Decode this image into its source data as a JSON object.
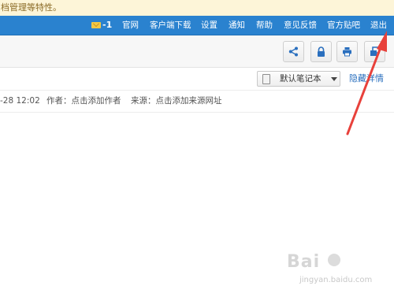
{
  "notice": {
    "text": "档管理等特性。"
  },
  "topnav": {
    "mail_count": "-1",
    "items": [
      {
        "label": "官网"
      },
      {
        "label": "客户端下载"
      },
      {
        "label": "设置"
      },
      {
        "label": "通知"
      },
      {
        "label": "帮助"
      },
      {
        "label": "意见反馈"
      },
      {
        "label": "官方贴吧"
      },
      {
        "label": "退出"
      }
    ],
    "colors": {
      "bar": "#2a82cf",
      "text": "#ffffff"
    }
  },
  "toolbar": {
    "buttons": [
      {
        "icon": "share-icon"
      },
      {
        "icon": "lock-icon"
      },
      {
        "icon": "print-icon"
      },
      {
        "icon": "window-icon"
      }
    ]
  },
  "notebook": {
    "selected": "默认笔记本",
    "hide_details": "隐藏详情"
  },
  "meta": {
    "date": "-28 12:02",
    "author": "作者：点击添加作者",
    "source": "来源：点击添加来源网址"
  },
  "annotation": {
    "arrow_color": "#e8413b"
  },
  "watermark": {
    "logo": "Bai",
    "url": "jingyan.baidu.com"
  }
}
